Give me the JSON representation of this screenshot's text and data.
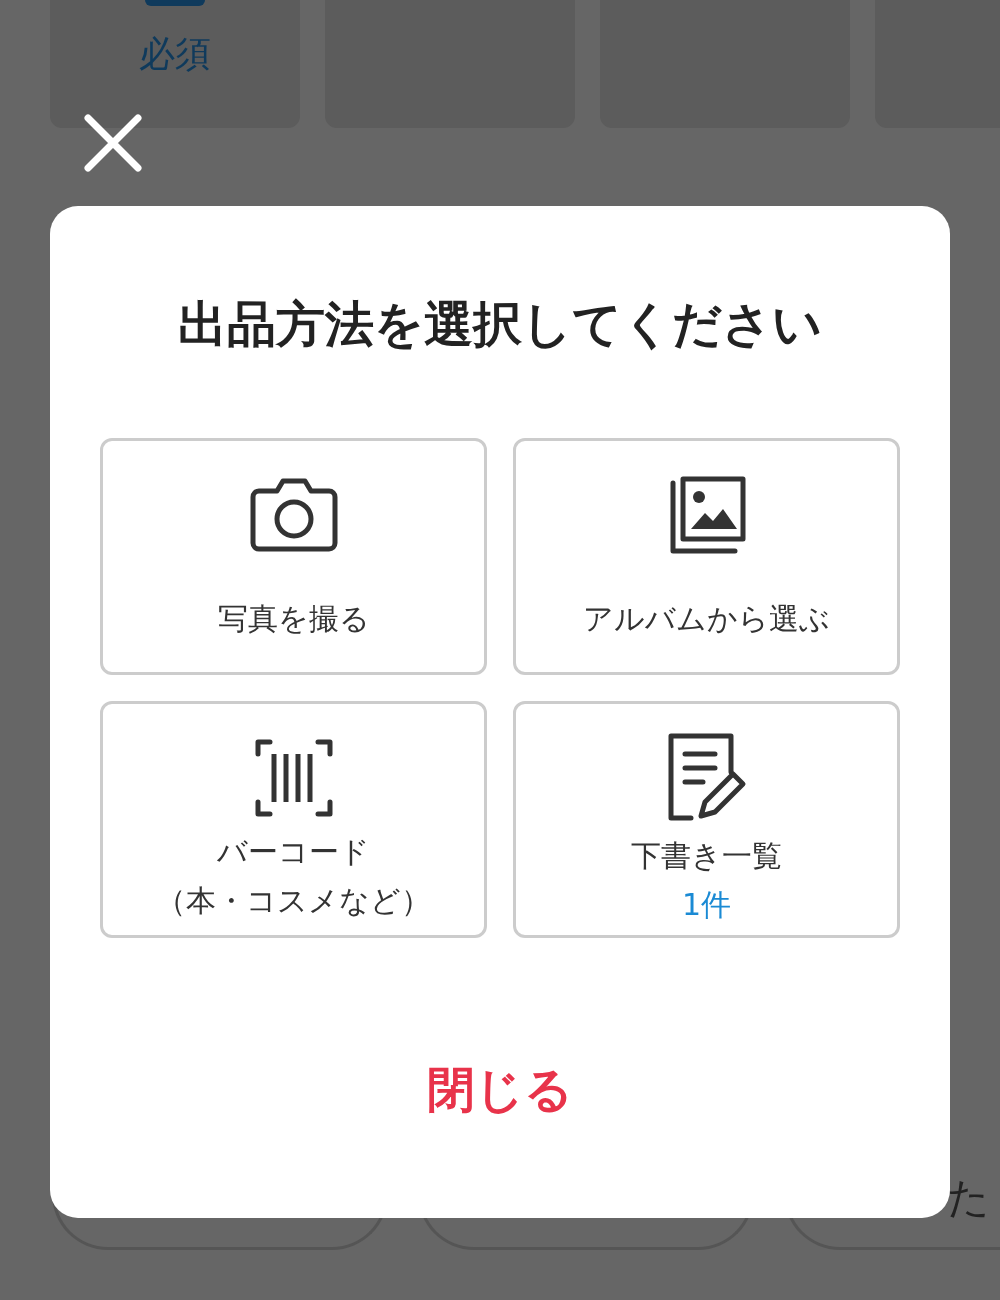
{
  "background": {
    "required_label": "必須",
    "cut_text": "た"
  },
  "modal": {
    "title": "出品方法を選択してください",
    "options": [
      {
        "kind": "camera",
        "label": "写真を撮る"
      },
      {
        "kind": "album",
        "label": "アルバムから選ぶ"
      },
      {
        "kind": "barcode",
        "label": "バーコード",
        "note": "（本・コスメなど）"
      },
      {
        "kind": "drafts",
        "label": "下書き一覧",
        "count": "1件"
      }
    ],
    "close_button": "閉じる"
  }
}
